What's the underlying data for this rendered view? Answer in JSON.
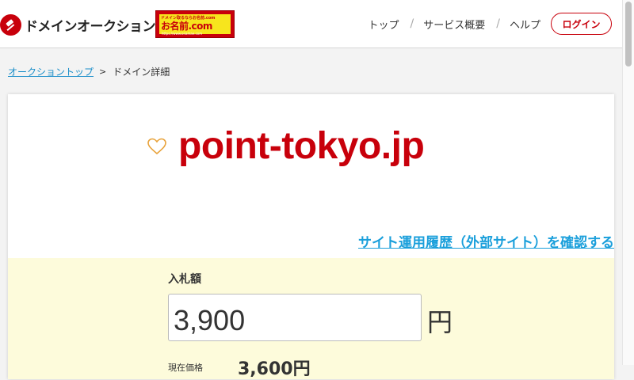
{
  "header": {
    "logo_text": "ドメインオークション",
    "banner": {
      "small_text": "ドメイン取るならお名前.com",
      "name": "お名前.com",
      "url": "https://www.onamae.com"
    },
    "nav": {
      "items": [
        {
          "label": "トップ"
        },
        {
          "label": "サービス概要"
        },
        {
          "label": "ヘルプ"
        }
      ],
      "separator": "/",
      "login_label": "ログイン"
    }
  },
  "breadcrumb": {
    "home_label": "オークショントップ",
    "separator": ">",
    "current_label": "ドメイン詳細"
  },
  "domain": {
    "name": "point-tokyo.jp",
    "history_link": "サイト運用履歴（外部サイト）を確認する"
  },
  "bid": {
    "label": "入札額",
    "value": "3,900",
    "currency": "円",
    "current_label": "現在価格",
    "current_price": "3,600円"
  },
  "colors": {
    "brand_red": "#c8000b",
    "link_blue": "#1a9fdb",
    "bid_bg": "#fdfbdb",
    "heart": "#e8a23a"
  },
  "icons": {
    "logo": "auction-hammer-icon",
    "favorite": "heart-outline-icon"
  }
}
